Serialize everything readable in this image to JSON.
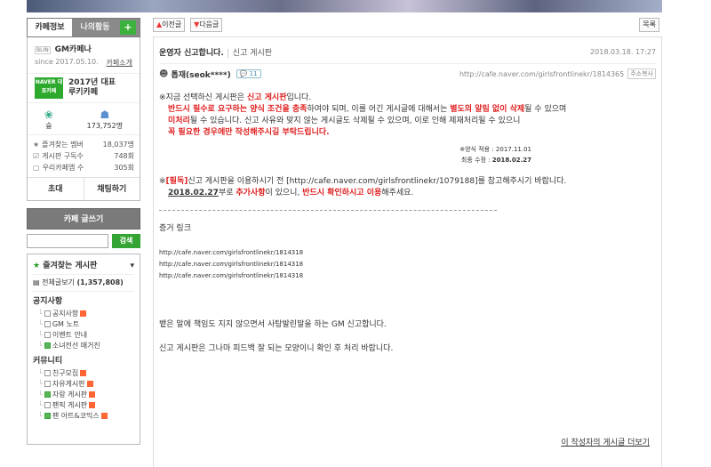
{
  "sidebar": {
    "tabs": [
      "카페정보",
      "나의활동",
      "+"
    ],
    "cafe_logo": "BLIN",
    "cafe_name": "GM카페나",
    "since": "since 2017.05.10.",
    "intro_link": "카페소개",
    "award_badge": "NAVER 대표카페",
    "award_text": [
      "2017년 대표",
      "루키카페"
    ],
    "stats": [
      {
        "icon": "rank-icon",
        "value": "숲"
      },
      {
        "icon": "members-icon",
        "value": "173,752명"
      }
    ],
    "rows": [
      {
        "label": "즐겨찾는 멤버",
        "value": "18,037명"
      },
      {
        "label": "게시판 구독수",
        "value": "748회"
      },
      {
        "label": "우리카페앱 수",
        "value": "305회"
      }
    ],
    "actions": [
      "초대",
      "채팅하기"
    ],
    "write_button": "카페 글쓰기",
    "search_button": "검색",
    "favorites": "즐겨찾는 게시판",
    "all_posts": "전체글보기",
    "all_count": "(1,357,808)",
    "sections": [
      {
        "title": "공지사항",
        "items": [
          {
            "label": "공지사항",
            "new": true,
            "green": false
          },
          {
            "label": "GM 노트",
            "new": false,
            "green": false
          },
          {
            "label": "이벤트 안내",
            "new": false,
            "green": false
          },
          {
            "label": "소녀전선 매거진",
            "new": false,
            "green": true
          }
        ]
      },
      {
        "title": "커뮤니티",
        "items": [
          {
            "label": "친구모집",
            "new": true,
            "green": false
          },
          {
            "label": "자유게시판",
            "new": true,
            "green": false
          },
          {
            "label": "자랑 게시판",
            "new": true,
            "green": true
          },
          {
            "label": "팬픽 게시판",
            "new": true,
            "green": false
          },
          {
            "label": "팬 아트&코믹스",
            "new": true,
            "green": true
          }
        ]
      }
    ]
  },
  "main": {
    "prev": "이전글",
    "next": "다음글",
    "list": "목록",
    "title": "운영자 신고합니다.",
    "category": "신고 게시판",
    "date": "2018.03.18. 17:27",
    "author": "톱재(seok****)",
    "comments": "11",
    "url": "http://cafe.naver.com/girlsfrontlinekr/1814365",
    "copy_url": "주소복사",
    "notice": {
      "l1_a": "※지금 선택하신 게시판은 ",
      "l1_red": "신고 게시판",
      "l1_b": "입니다.",
      "l2_red1": "반드시 필수로 요구하는 양식 조건을 충족",
      "l2_a": "하여야 되며, 이를 어긴 게시글에 대해서는 ",
      "l2_red2": "별도의 알림 없이 삭제",
      "l2_b": "될 수 있으며",
      "l3_red": "미처리",
      "l3_a": "될 수 있습니다. 신고 사유와 맞지 않는 게시글도 삭제될 수 있으며, 이로 인해 제재처리될 수 있으니",
      "l4_red": "꼭 필요한 경우에만 작성해주시길 부탁드립니다.",
      "applied": "※양식 적용 : 2017.11.01",
      "modified_label": "최종 수정 : ",
      "modified": "2018.02.27",
      "l5_a": "※",
      "l5_red": "[필독]",
      "l5_b": "신고 게시판을 이용하시기 전 [http://cafe.naver.com/girlsfrontlinekr/1079188]를 참고해주시기 바랍니다.",
      "l6_date": "2018.02.27",
      "l6_a": "부로 ",
      "l6_red1": "추가사항",
      "l6_b": "이 있으니, ",
      "l6_red2": "반드시 확인하시고 이용",
      "l6_c": "해주세요."
    },
    "evidence_label": "증거 링크",
    "links": [
      "http://cafe.naver.com/girlsfrontlinekr/1814318",
      "http://cafe.naver.com/girlsfrontlinekr/1814318",
      "http://cafe.naver.com/girlsfrontlinekr/1814318"
    ],
    "body1": "뱉은 말에 책임도 지지 않으면서 사탕발린말을 하는 GM 신고합니다.",
    "body2": "신고 게시판은 그나마 피드백 잘 되는 모양이니 확인 후 처리 바랍니다.",
    "more_posts": "이 작성자의 게시글 더보기"
  }
}
